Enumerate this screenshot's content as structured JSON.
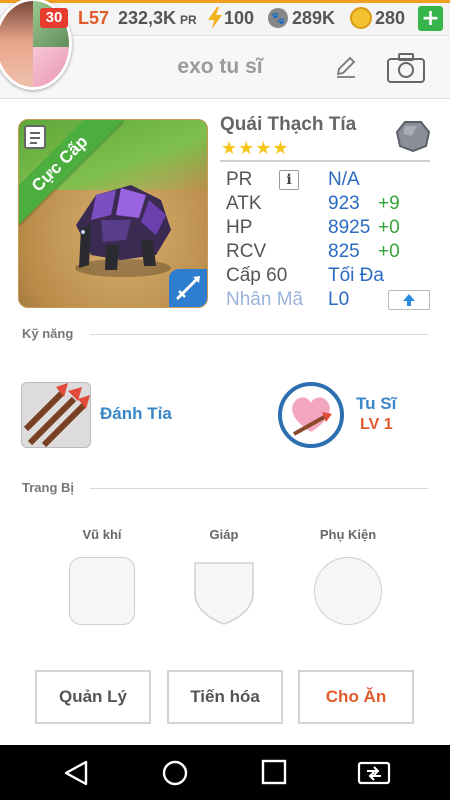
{
  "status_bar": {
    "avatar_level": "30",
    "player_level": "L57",
    "pr_value": "232,3K",
    "pr_unit": "PR",
    "energy": "100",
    "food": "289K",
    "coins": "280",
    "add_label": "+"
  },
  "header": {
    "title": "exo tu sĩ"
  },
  "monster": {
    "rank_ribbon": "Cực Cấp",
    "name": "Quái Thạch Tía",
    "stars": "★★★★",
    "star_count": 4,
    "stats": [
      {
        "label": "PR",
        "value": "N/A",
        "bonus": ""
      },
      {
        "label": "ATK",
        "value": "923",
        "bonus": "+9"
      },
      {
        "label": "HP",
        "value": "8925",
        "bonus": "+0"
      },
      {
        "label": "RCV",
        "value": "825",
        "bonus": "+0"
      },
      {
        "label": "Cấp 60",
        "value": "Tối Đa",
        "bonus": ""
      },
      {
        "label": "Nhân Mã",
        "value": "L0",
        "bonus": ""
      }
    ],
    "info_button": "i"
  },
  "skills": {
    "section_label": "Kỹ năng",
    "active": {
      "name": "Đánh Tỉa"
    },
    "passive": {
      "name": "Tu Sĩ",
      "level": "LV 1"
    }
  },
  "equipment": {
    "section_label": "Trang Bị",
    "weapon_label": "Vũ khí",
    "armor_label": "Giáp",
    "accessory_label": "Phụ Kiện"
  },
  "actions": {
    "manage": "Quản Lý",
    "evolve": "Tiến hóa",
    "feed": "Cho Ăn"
  },
  "colors": {
    "accent_orange": "#e05a2a",
    "value_blue": "#2a6bc0",
    "bonus_green": "#37a23b",
    "ribbon_green": "#4cae3f"
  }
}
